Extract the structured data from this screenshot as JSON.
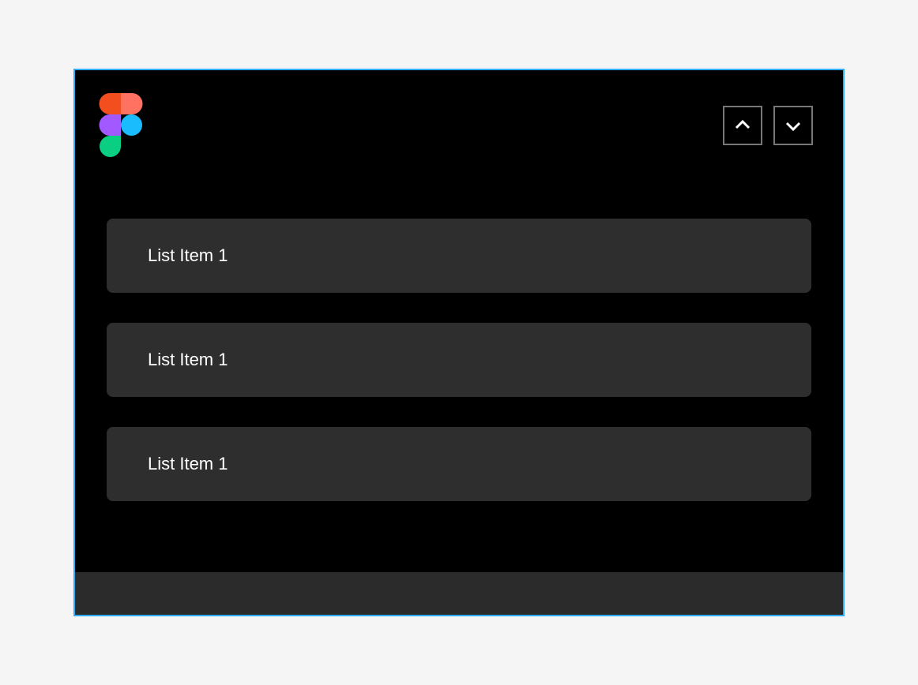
{
  "header": {
    "logo_name": "figma-logo",
    "colors": {
      "red": "#f24e1e",
      "orange": "#ff7262",
      "purple": "#a259ff",
      "blue": "#1abcfe",
      "green": "#0acf83"
    },
    "nav_up_title": "Up",
    "nav_down_title": "Down"
  },
  "list": {
    "items": [
      {
        "label": "List Item 1"
      },
      {
        "label": "List Item 1"
      },
      {
        "label": "List Item 1"
      }
    ]
  },
  "colors": {
    "panel_border": "#2dabf9",
    "panel_bg": "#000000",
    "list_item_bg": "#2e2e2e",
    "footer_bg": "#2b2b2b",
    "text": "#ffffff",
    "nav_border": "#777777"
  }
}
